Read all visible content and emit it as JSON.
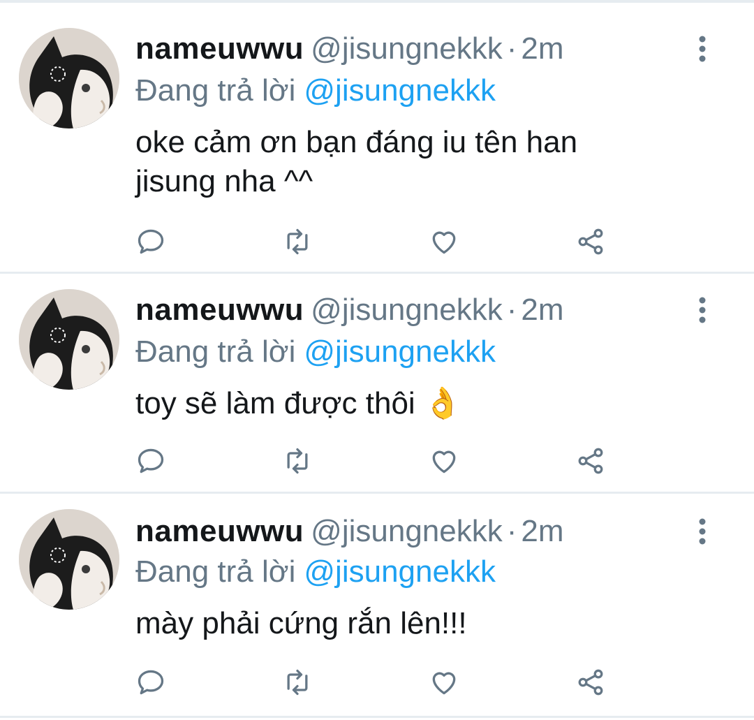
{
  "tweets": [
    {
      "display_name": "nameuwwu",
      "handle": "@jisungnekkk",
      "separator": "·",
      "time": "2m",
      "reply_prefix": "Đang trả lời",
      "reply_to": "@jisungnekkk",
      "text_lines": [
        "oke cảm ơn bạn đáng iu tên han",
        "jisung nha ^^"
      ],
      "icons": {
        "more": "more-vertical-icon",
        "reply": "reply-icon",
        "retweet": "retweet-icon",
        "like": "heart-icon",
        "share": "share-icon"
      }
    },
    {
      "display_name": "nameuwwu",
      "handle": "@jisungnekkk",
      "separator": "·",
      "time": "2m",
      "reply_prefix": "Đang trả lời",
      "reply_to": "@jisungnekkk",
      "text_lines": [
        "toy sẽ làm được thôi 👌"
      ],
      "icons": {
        "more": "more-vertical-icon",
        "reply": "reply-icon",
        "retweet": "retweet-icon",
        "like": "heart-icon",
        "share": "share-icon"
      }
    },
    {
      "display_name": "nameuwwu",
      "handle": "@jisungnekkk",
      "separator": "·",
      "time": "2m",
      "reply_prefix": "Đang trả lời",
      "reply_to": "@jisungnekkk",
      "text_lines": [
        "mày phải cứng rắn lên!!!"
      ],
      "icons": {
        "more": "more-vertical-icon",
        "reply": "reply-icon",
        "retweet": "retweet-icon",
        "like": "heart-icon",
        "share": "share-icon"
      }
    }
  ],
  "colors": {
    "text": "#14171a",
    "secondary": "#657786",
    "mention": "#1da1f2",
    "divider": "#e6ecf0",
    "icon": "#657786"
  }
}
